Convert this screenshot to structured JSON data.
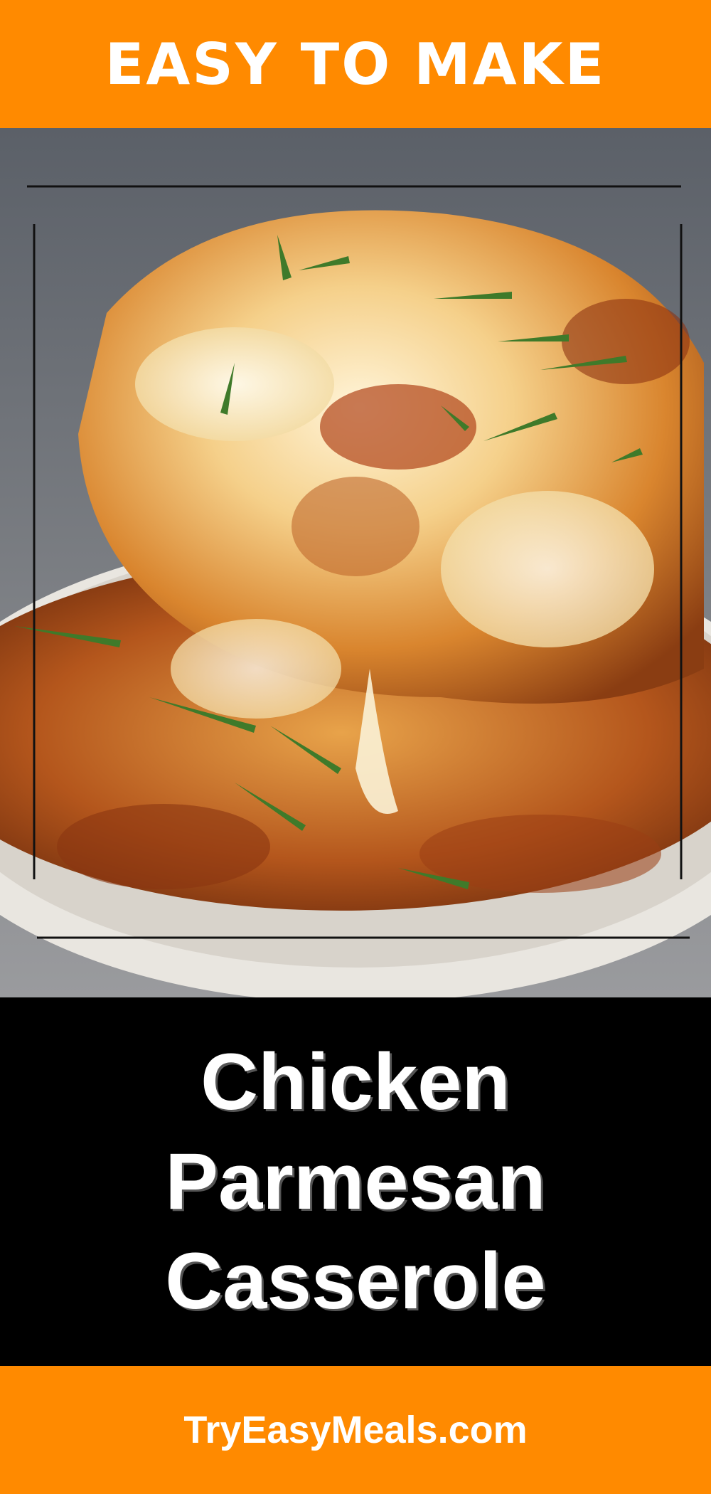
{
  "top_banner": {
    "text": "EASY TO MAKE"
  },
  "title": {
    "lines": [
      "Chicken",
      "Parmesan",
      "Casserole"
    ]
  },
  "bottom_banner": {
    "text": "TryEasyMeals.com"
  },
  "colors": {
    "banner": "#ff8a00",
    "title_background": "#000000",
    "text": "#ffffff",
    "frame_lines": "#111111"
  }
}
